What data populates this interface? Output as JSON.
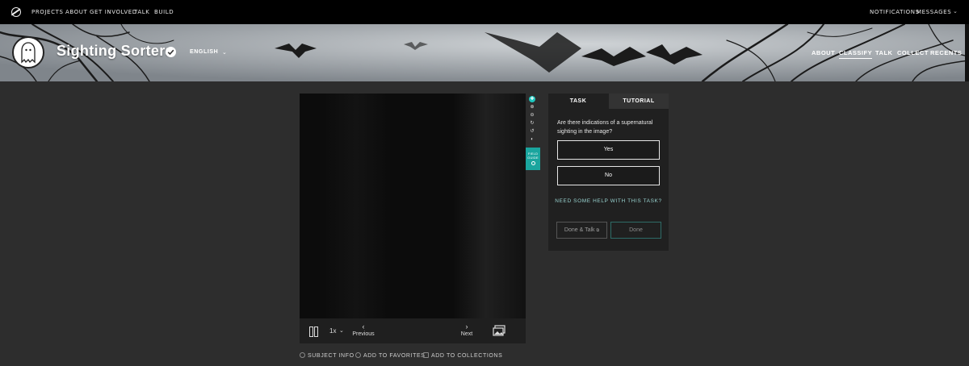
{
  "topnav": {
    "items": [
      "PROJECTS",
      "ABOUT",
      "GET INVOLVED",
      "TALK",
      "BUILD"
    ],
    "notifications": "NOTIFICATIONS",
    "messages": "MESSAGES"
  },
  "project": {
    "title": "Sighting Sorters",
    "language": "ENGLISH",
    "nav": [
      "ABOUT",
      "CLASSIFY",
      "TALK",
      "COLLECT",
      "RECENTS"
    ],
    "active_nav": "CLASSIFY"
  },
  "viewer": {
    "playback_rate": "1x",
    "previous_label": "Previous",
    "next_label": "Next",
    "field_guide_label": "FIELD GUIDE",
    "links": {
      "subject_info": "SUBJECT INFO",
      "add_to_favorites": "ADD TO FAVORITES",
      "add_to_collections": "ADD TO COLLECTIONS"
    }
  },
  "task_panel": {
    "tabs": [
      "TASK",
      "TUTORIAL"
    ],
    "active_tab": "TASK",
    "question": "Are there indications of a supernatural sighting in the image?",
    "answers": [
      "Yes",
      "No"
    ],
    "help_link": "NEED SOME HELP WITH THIS TASK?",
    "done_talk_label": "Done & Talk",
    "done_label": "Done"
  },
  "colors": {
    "accent": "#1ec6be",
    "page_bg": "#2d2d2d",
    "topbar_bg": "#000000"
  }
}
